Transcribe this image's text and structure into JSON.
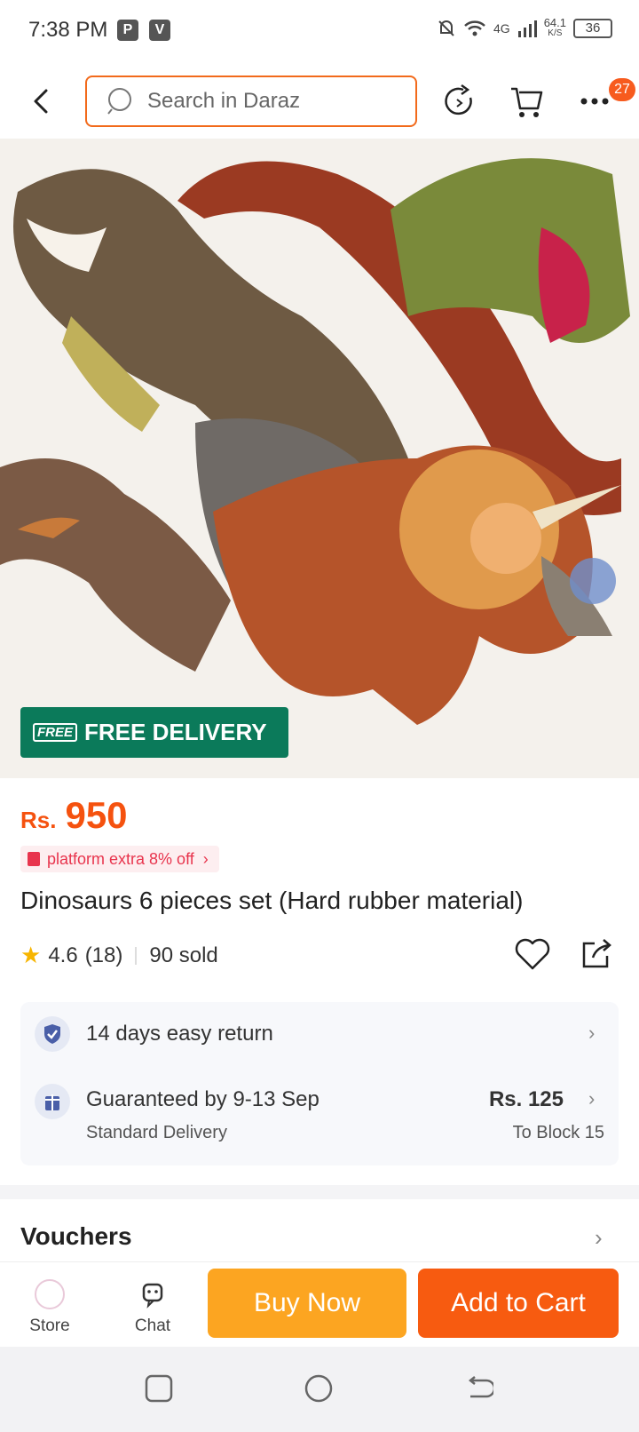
{
  "status_bar": {
    "time": "7:38 PM",
    "app_icon_1": "P",
    "app_icon_2": "V",
    "network": "4G",
    "speed_value": "64.1",
    "speed_unit": "K/S",
    "battery": "36"
  },
  "header": {
    "search_placeholder": "Search in Daraz",
    "cart_badge": "27"
  },
  "hero": {
    "free_tag": "FREE",
    "free_delivery": "FREE DELIVERY"
  },
  "product": {
    "currency": "Rs.",
    "price": "950",
    "promo": "platform extra 8% off",
    "title": "Dinosaurs 6 pieces set (Hard rubber material)",
    "rating": "4.6",
    "reviews": "(18)",
    "sold": "90 sold"
  },
  "services": {
    "return_label": "14 days easy return",
    "delivery_label": "Guaranteed by 9-13 Sep",
    "delivery_sub": "Standard Delivery",
    "delivery_price": "Rs. 125",
    "delivery_to": "To Block 15"
  },
  "vouchers": {
    "label": "Vouchers"
  },
  "bottom_bar": {
    "store": "Store",
    "chat": "Chat",
    "buy_now": "Buy Now",
    "add_to_cart": "Add to Cart"
  },
  "colors": {
    "accent": "#f75b10",
    "buy": "#fca521",
    "price": "#f5520f",
    "free_delivery_bg": "#0b7a5a"
  }
}
